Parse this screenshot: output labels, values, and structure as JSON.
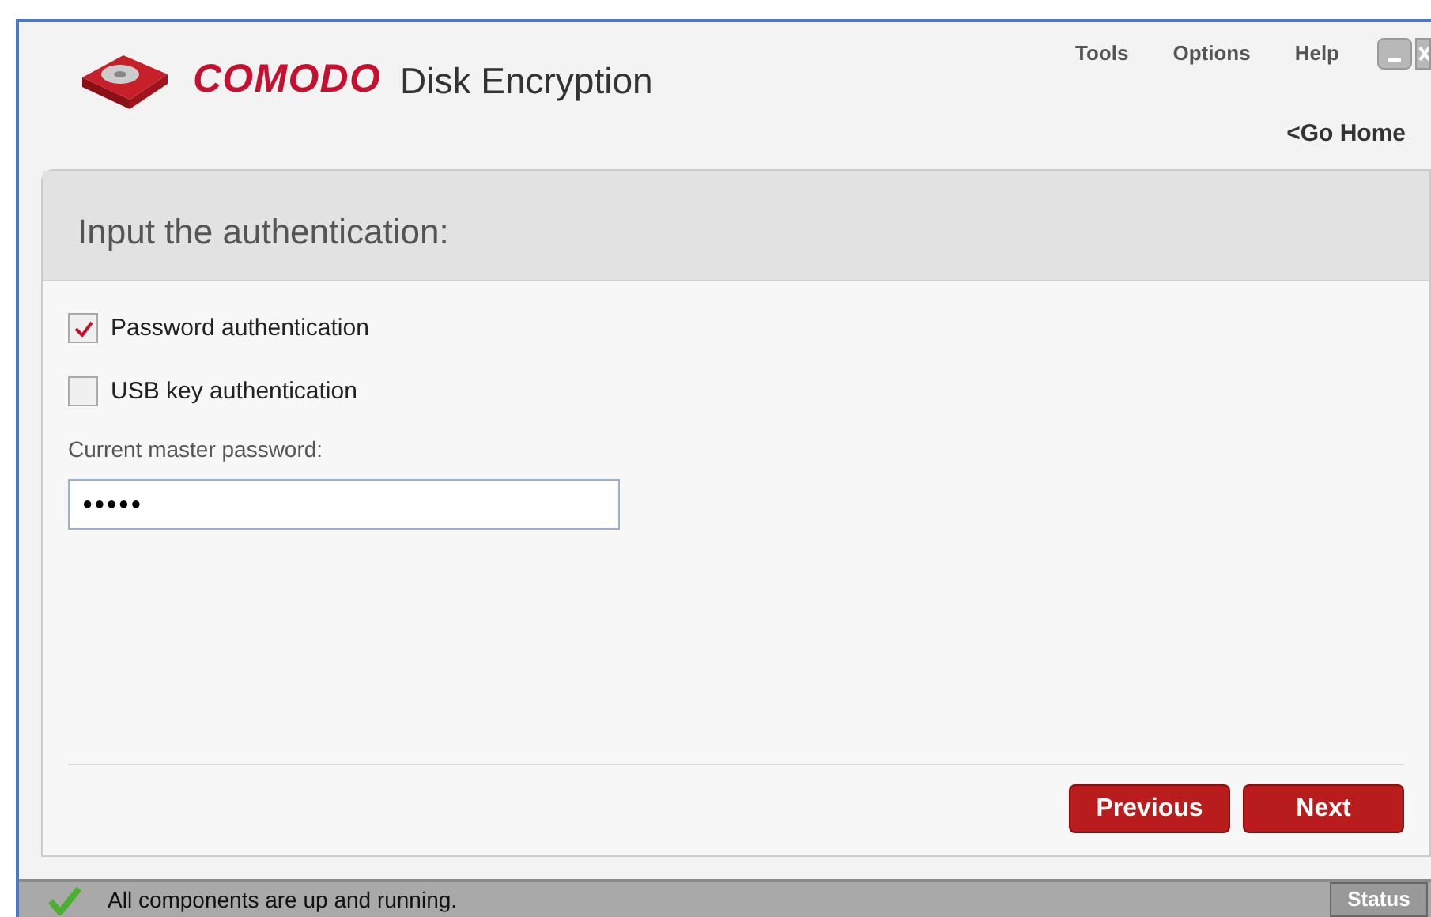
{
  "header": {
    "brand": "COMODO",
    "product": "Disk Encryption",
    "menu": [
      "Tools",
      "Options",
      "Help"
    ],
    "home_link": "<Go Home"
  },
  "panel": {
    "title": "Input the authentication:",
    "options": [
      {
        "label": "Password authentication",
        "checked": true
      },
      {
        "label": "USB key authentication",
        "checked": false
      }
    ],
    "password": {
      "label": "Current master password:",
      "value": "●●●●●"
    },
    "buttons": [
      "Previous",
      "Next"
    ]
  },
  "status_bar": {
    "message": "All components are up and running.",
    "button": "Status"
  }
}
